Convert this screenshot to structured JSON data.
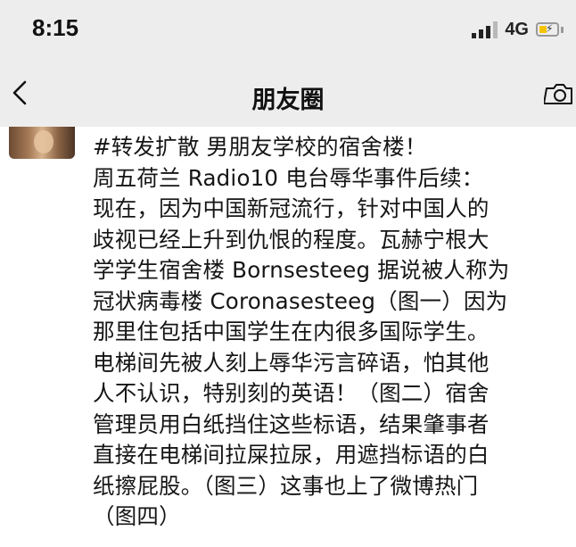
{
  "status_bar": {
    "time": "8:15",
    "network": "4G",
    "icons": [
      "signal-icon",
      "battery-charging-icon"
    ]
  },
  "nav_bar": {
    "title": "朋友圈",
    "icons": [
      "back-arrow-icon",
      "camera-icon"
    ]
  },
  "post": {
    "avatar_icon": "user-avatar",
    "lines": [
      "#转发扩散 男朋友学校的宿舍楼！",
      "周五荷兰 Radio10 电台辱华事件后续：",
      "现在，因为中国新冠流行，针对中国人的",
      "歧视已经上升到仇恨的程度。瓦赫宁根大",
      "学学生宿舍楼 Bornsesteeg 据说被人称为",
      "冠状病毒楼 Coronasesteeg（图一）因为",
      "那里住包括中国学生在内很多国际学生。",
      "电梯间先被人刻上辱华污言碎语，怕其他",
      "人不认识，特别刻的英语！（图二）宿舍",
      "管理员用白纸挡住这些标语，结果肇事者",
      "直接在电梯间拉屎拉尿，用遮挡标语的白",
      "纸擦屁股。（图三）这事也上了微博热门",
      "（图四）"
    ]
  },
  "colors": {
    "header_bg": "#ededed",
    "battery_fill": "#f5c400",
    "text": "#151515"
  }
}
